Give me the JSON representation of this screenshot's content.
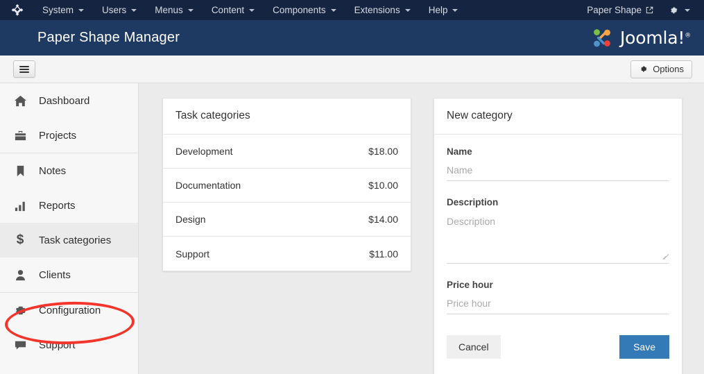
{
  "topbar": {
    "brand_icon": "joomla-monogram-icon",
    "menu": [
      {
        "label": "System",
        "icon": "chevron-down-icon"
      },
      {
        "label": "Users",
        "icon": "chevron-down-icon"
      },
      {
        "label": "Menus",
        "icon": "chevron-down-icon"
      },
      {
        "label": "Content",
        "icon": "chevron-down-icon"
      },
      {
        "label": "Components",
        "icon": "chevron-down-icon"
      },
      {
        "label": "Extensions",
        "icon": "chevron-down-icon"
      },
      {
        "label": "Help",
        "icon": "chevron-down-icon"
      }
    ],
    "site_name": "Paper Shape",
    "site_link_icon": "external-link-icon",
    "settings_icon": "gear-icon",
    "settings_caret_icon": "chevron-down-icon",
    "background_color": "#152440"
  },
  "subheader": {
    "title": "Paper Shape Manager",
    "logo_text": "Joomla!",
    "logo_sup": "®",
    "background_color": "#1e3a63"
  },
  "toolbar": {
    "menu_toggle_icon": "hamburger-menu-icon",
    "options_label": "Options",
    "options_icon": "gear-icon"
  },
  "sidebar": {
    "items": [
      {
        "label": "Dashboard",
        "icon": "home-icon",
        "active": false
      },
      {
        "label": "Projects",
        "icon": "briefcase-icon",
        "active": false
      },
      {
        "label": "Notes",
        "icon": "bookmark-icon",
        "active": false
      },
      {
        "label": "Reports",
        "icon": "bar-chart-icon",
        "active": false
      },
      {
        "label": "Task categories",
        "icon": "dollar-icon",
        "active": true
      },
      {
        "label": "Clients",
        "icon": "user-icon",
        "active": false
      },
      {
        "label": "Configuration",
        "icon": "gear-icon",
        "active": false
      },
      {
        "label": "Support",
        "icon": "comment-icon",
        "active": false
      }
    ],
    "annotation": {
      "type": "red-ellipse-highlight",
      "target": "Task categories",
      "color": "#f4352c"
    }
  },
  "task_categories_card": {
    "title": "Task categories",
    "rows": [
      {
        "name": "Development",
        "price": "$18.00"
      },
      {
        "name": "Documentation",
        "price": "$10.00"
      },
      {
        "name": "Design",
        "price": "$14.00"
      },
      {
        "name": "Support",
        "price": "$11.00"
      }
    ]
  },
  "new_category_card": {
    "title": "New category",
    "fields": {
      "name": {
        "label": "Name",
        "value": "",
        "placeholder": "Name"
      },
      "description": {
        "label": "Description",
        "value": "",
        "placeholder": "Description"
      },
      "price_hour": {
        "label": "Price hour",
        "value": "",
        "placeholder": "Price hour"
      }
    },
    "cancel_label": "Cancel",
    "save_label": "Save",
    "save_color": "#337ab7"
  }
}
